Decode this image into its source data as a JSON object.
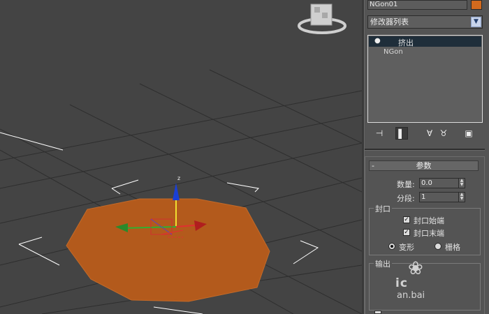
{
  "object": {
    "name": "NGon01",
    "color": "#d26a1e"
  },
  "modifier_list": {
    "label": "修改器列表",
    "arrow": "▼"
  },
  "stack": {
    "selected": {
      "bulb": "💡",
      "label": "挤出"
    },
    "base": {
      "label": "NGon"
    }
  },
  "stack_tools": [
    "pin-stack-icon",
    "show-end-result-icon",
    "make-unique-icon",
    "remove-modifier-icon",
    "configure-modifier-sets-icon"
  ],
  "parameters": {
    "collapse_symbol": "-",
    "title": "参数",
    "amount_label": "数量:",
    "amount_value": "0.0",
    "segments_label": "分段:",
    "segments_value": "1",
    "capping": {
      "title": "封口",
      "cap_start": "封口始端",
      "cap_end": "封口末端",
      "morph": "变形",
      "grid": "栅格"
    },
    "output": {
      "title": "输出"
    }
  },
  "viewport": {
    "gizmo_z_label": "z",
    "object_color": "#b35a1c"
  },
  "watermark": {
    "line1": "ic",
    "line2": "an.bai",
    "paw": "🐾"
  }
}
